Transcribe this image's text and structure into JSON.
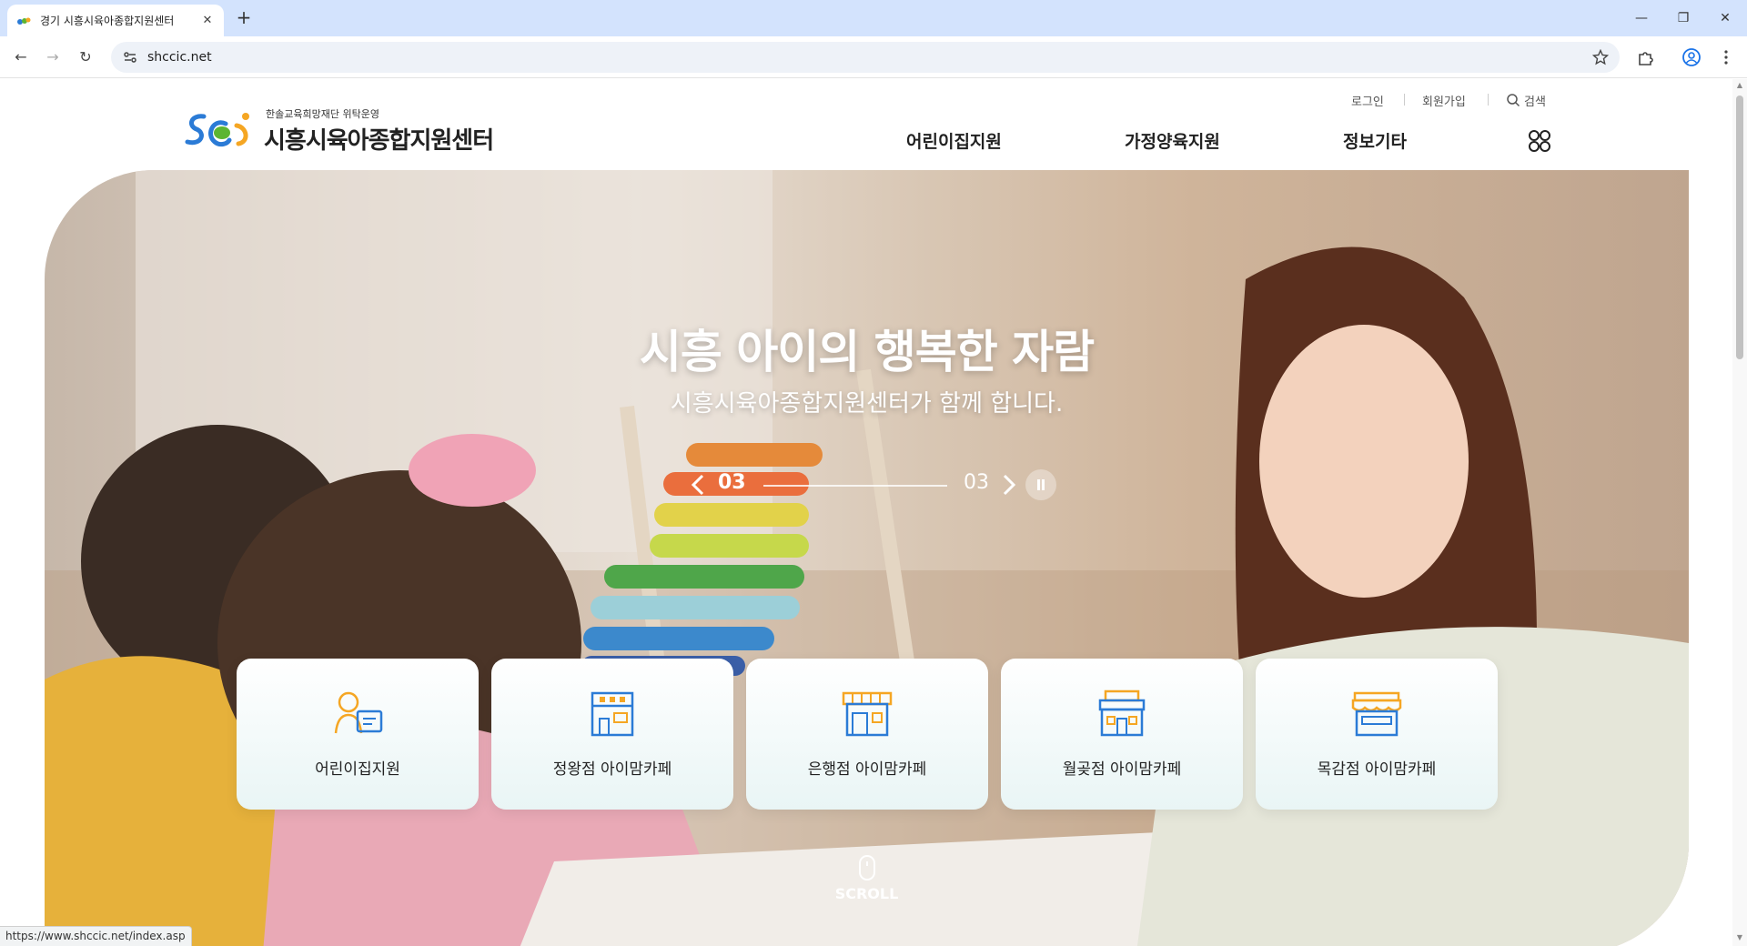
{
  "browser": {
    "tab_title": "경기 시흥시육아종합지원센터",
    "url": "shccic.net",
    "status_url": "https://www.shccic.net/index.asp"
  },
  "header": {
    "logo_sub": "한솔교육희망재단 위탁운영",
    "logo_main": "시흥시육아종합지원센터",
    "util": {
      "login": "로그인",
      "join": "회원가입",
      "search": "검색"
    },
    "gnb": [
      "어린이집지원",
      "가정양육지원",
      "정보기타"
    ],
    "all_menu_icon": "four-circles-icon"
  },
  "hero": {
    "title": "시흥 아이의 행복한 자람",
    "subtitle": "시흥시육아종합지원센터가 함께 합니다.",
    "slide_current": "03",
    "slide_total": "03",
    "scroll_label": "SCROLL"
  },
  "quick_links": [
    {
      "label": "어린이집지원",
      "icon": "teacher-icon"
    },
    {
      "label": "정왕점 아이맘카페",
      "icon": "building-icon"
    },
    {
      "label": "은행점 아이맘카페",
      "icon": "store-icon"
    },
    {
      "label": "월곶점 아이맘카페",
      "icon": "shop-icon"
    },
    {
      "label": "목감점 아이맘카페",
      "icon": "awning-store-icon"
    }
  ],
  "colors": {
    "accent_orange": "#f5a623",
    "accent_blue": "#2b7bd6",
    "logo_green": "#5cb531"
  }
}
